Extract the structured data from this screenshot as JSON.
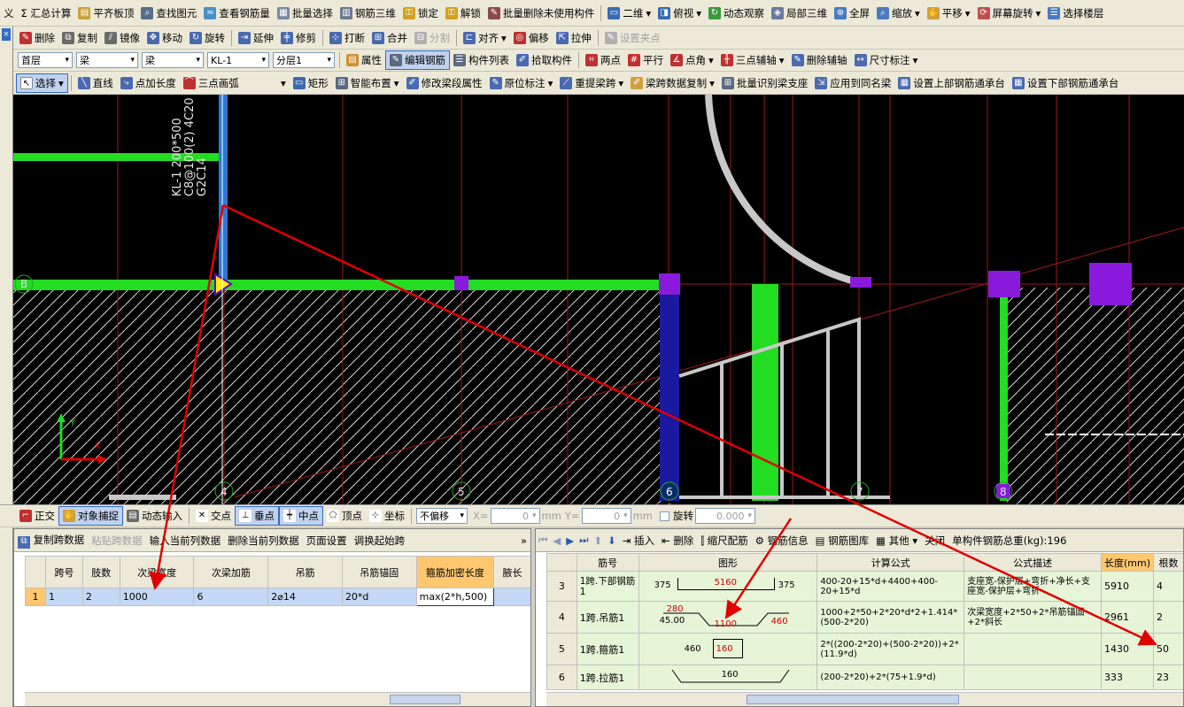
{
  "toolbar1": {
    "items": [
      "义",
      "Σ 汇总计算",
      "平齐板顶",
      "查找图元",
      "查看钢筋量",
      "批量选择",
      "钢筋三维",
      "锁定",
      "解锁",
      "批量删除未使用构件",
      "二维",
      "俯视",
      "动态观察",
      "局部三维",
      "全屏",
      "缩放",
      "平移",
      "屏幕旋转",
      "选择楼层"
    ]
  },
  "toolbar2": {
    "items": [
      "删除",
      "复制",
      "镜像",
      "移动",
      "旋转",
      "延伸",
      "修剪",
      "打断",
      "合并",
      "分割",
      "对齐",
      "偏移",
      "拉伸",
      "设置夹点"
    ]
  },
  "toolbar3": {
    "floor": "首层",
    "type1": "梁",
    "type2": "梁",
    "member": "KL-1",
    "layer": "分层1",
    "items": [
      "属性",
      "编辑钢筋",
      "构件列表",
      "拾取构件",
      "两点",
      "平行",
      "点角",
      "三点辅轴",
      "删除辅轴",
      "尺寸标注"
    ]
  },
  "toolbar4": {
    "items": [
      "选择",
      "直线",
      "点加长度",
      "三点画弧",
      "矩形",
      "智能布置",
      "修改梁段属性",
      "原位标注",
      "重提梁跨",
      "梁跨数据复制",
      "批量识别梁支座",
      "应用到同名梁",
      "设置上部钢筋通承台",
      "设置下部钢筋通承台"
    ]
  },
  "canvas": {
    "beam_label": [
      "KL-1 200*500",
      "C8@100(2) 4C20",
      "G2C14"
    ],
    "axis_labels": [
      "4",
      "5",
      "6",
      "7",
      "8"
    ],
    "left_axis": "B"
  },
  "statusbar": {
    "items": [
      "正交",
      "对象捕捉",
      "动态输入",
      "交点",
      "垂点",
      "中点",
      "顶点",
      "坐标"
    ],
    "offset_mode": "不偏移",
    "x_label": "X=",
    "x_value": "0",
    "y_label": "Y=",
    "y_value": "0",
    "unit": "mm",
    "rotate_label": "旋转",
    "rotate_value": "0.000"
  },
  "left_panel": {
    "toolbar": [
      "复制跨数据",
      "粘贴跨数据",
      "输入当前列数据",
      "删除当前列数据",
      "页面设置",
      "调换起始跨"
    ],
    "headers": [
      "跨号",
      "肢数",
      "次梁宽度",
      "次梁加筋",
      "吊筋",
      "吊筋锚固",
      "箍筋加密长度",
      "腋长"
    ],
    "rows": [
      [
        "1",
        "1",
        "2",
        "1000",
        "6",
        "2⌀14",
        "20*d",
        "max(2*h,500)",
        ""
      ]
    ]
  },
  "right_panel": {
    "toolbar": [
      "插入",
      "删除",
      "缩尺配筋",
      "钢筋信息",
      "钢筋图库",
      "其他",
      "关闭"
    ],
    "total_label": "单构件钢筋总重(kg):196",
    "headers": [
      "筋号",
      "图形",
      "计算公式",
      "公式描述",
      "长度(mm)",
      "根数"
    ],
    "rows": [
      {
        "no": "3",
        "name": "1跨.下部钢筋1",
        "shape": [
          "375",
          "5160",
          "375"
        ],
        "formula": "400-20+15*d+4400+400-20+15*d",
        "desc": "支座宽-保护层+弯折+净长+支座宽-保护层+弯折",
        "length": "5910",
        "count": "4"
      },
      {
        "no": "4",
        "name": "1跨.吊筋1",
        "shape": [
          "280",
          "45.00",
          "1100",
          "460"
        ],
        "formula": "1000+2*50+2*20*d*2+1.414*(500-2*20)",
        "desc": "次梁宽度+2*50+2*吊筋锚固+2*斜长",
        "length": "2961",
        "count": "2"
      },
      {
        "no": "5",
        "name": "1跨.箍筋1",
        "shape": [
          "460",
          "160"
        ],
        "formula": "2*((200-2*20)+(500-2*20))+2*(11.9*d)",
        "desc": "",
        "length": "1430",
        "count": "50"
      },
      {
        "no": "6",
        "name": "1跨.拉筋1",
        "shape": [
          "160"
        ],
        "formula": "(200-2*20)+2*(75+1.9*d)",
        "desc": "",
        "length": "333",
        "count": "23"
      }
    ]
  },
  "colors": {
    "canvas_bg": "#000000",
    "beam_green": "#22dd22",
    "column_purple": "#8a1adb",
    "annotation_red": "#e00000",
    "toolbar_bg": "#ece9d8",
    "highlight_header": "#ffc870"
  }
}
